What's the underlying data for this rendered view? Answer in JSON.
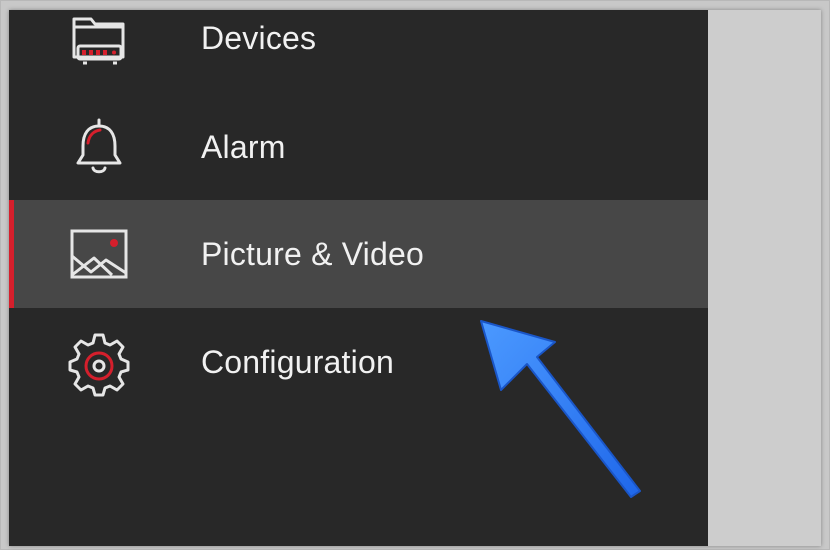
{
  "menu": {
    "items": [
      {
        "label": "Devices",
        "icon": "devices-icon",
        "selected": false
      },
      {
        "label": "Alarm",
        "icon": "bell-icon",
        "selected": false
      },
      {
        "label": "Picture & Video",
        "icon": "picture-icon",
        "selected": true
      },
      {
        "label": "Configuration",
        "icon": "gear-icon",
        "selected": false
      }
    ]
  },
  "colors": {
    "drawer_background": "#282828",
    "selected_background": "#474747",
    "accent_red": "#d51f2c",
    "text": "#f1f1f1",
    "icon_stroke": "#e6e6e6",
    "annotation_arrow": "#2f7cff"
  }
}
